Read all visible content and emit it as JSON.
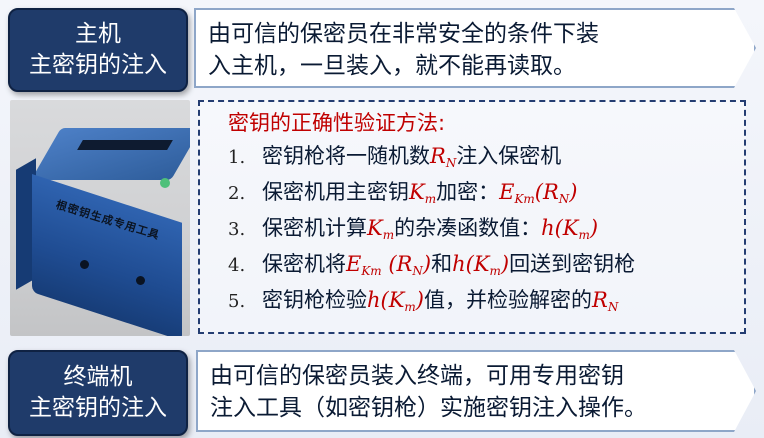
{
  "master_injection": {
    "label_line1": "主机",
    "label_line2": "主密钥的注入",
    "description_line1": "由可信的保密员在非常安全的条件下装",
    "description_line2": "入主机，一旦装入，就不能再读取。"
  },
  "device_photo": {
    "printed_text": "根密钥生成专用工具"
  },
  "verification": {
    "title": "密钥的正确性验证方法:",
    "steps": [
      {
        "num": "1.",
        "pre": "密钥枪将一随机数",
        "m1": "R",
        "m1_sub": "N",
        "post": "注入保密机"
      },
      {
        "num": "2.",
        "pre": "保密机用主密钥",
        "m1": "K",
        "m1_sub": "m",
        "mid": "加密：",
        "m2": "E",
        "m2_sub": "Km",
        "m2_arg": "(R",
        "m2_arg_sub": "N",
        "m2_close": ")"
      },
      {
        "num": "3.",
        "pre": "保密机计算",
        "m1": "K",
        "m1_sub": "m",
        "mid": "的杂凑函数值：",
        "m2": "h(K",
        "m2_sub": "m",
        "m2_close": ")"
      },
      {
        "num": "4.",
        "pre": "保密机将",
        "m1": "E",
        "m1_sub": "Km",
        "m1_arg": " (R",
        "m1_arg_sub": "N",
        "m1_close": ")",
        "mid": " 和",
        "m2": "h(K",
        "m2_sub": "m",
        "m2_close": ")",
        "post": "回送到密钥枪"
      },
      {
        "num": "5.",
        "pre": "密钥枪检验 ",
        "m1": "h(K",
        "m1_sub": "m",
        "m1_close": ")",
        "mid": " 值，并检验解密的",
        "m2": "R",
        "m2_sub": "N"
      }
    ]
  },
  "terminal_injection": {
    "label_line1": "终端机",
    "label_line2": "主密钥的注入",
    "description_line1": "由可信的保密员装入终端，可用专用密钥",
    "description_line2": "注入工具（如密钥枪）实施密钥注入操作。"
  },
  "colors": {
    "label_bg": "#1f3b6a",
    "accent_red": "#c00000",
    "dashed_border": "#243d72"
  }
}
